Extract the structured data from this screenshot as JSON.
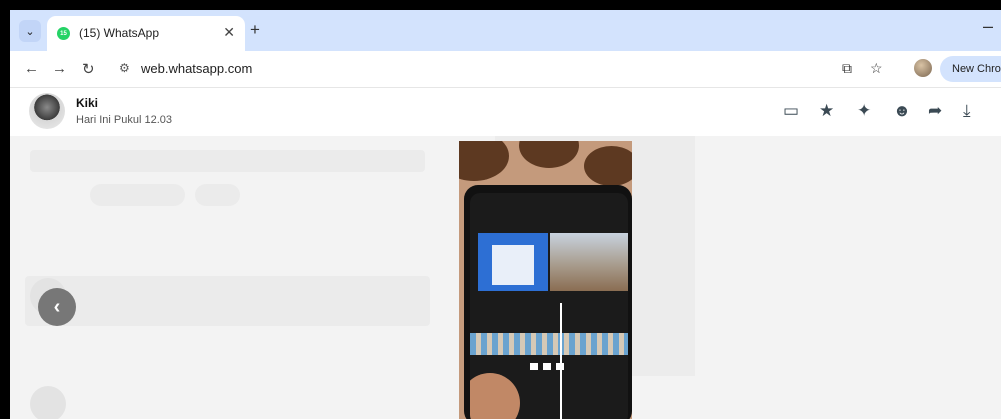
{
  "browser": {
    "tab_title": "(15) WhatsApp",
    "tab_favicon_text": "15",
    "url": "web.whatsapp.com",
    "new_chrome_label": "New Chrom",
    "accent": "#d3e3fd"
  },
  "viewer": {
    "contact_name": "Kiki",
    "timestamp": "Hari Ini Pukul 12.03",
    "header_icons": [
      "message-icon",
      "star-icon",
      "pin-icon",
      "emoji-icon",
      "forward-icon",
      "download-icon"
    ]
  }
}
